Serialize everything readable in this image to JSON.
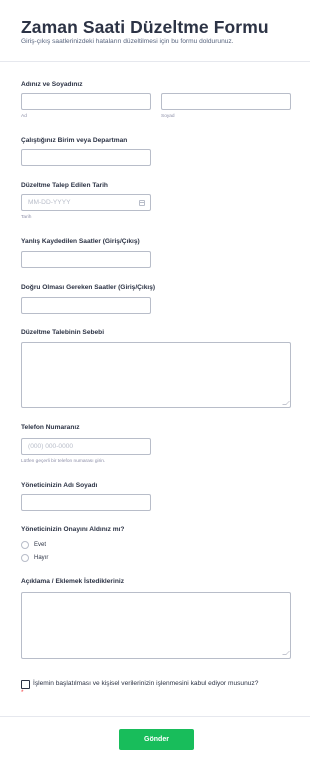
{
  "header": {
    "title": "Zaman Saati Düzeltme Formu",
    "subtitle": "Giriş-çıkış saatlerinizdeki hataların düzeltilmesi için bu formu doldurunuz."
  },
  "fields": {
    "name": {
      "label": "Adınız ve Soyadınız",
      "first_sublabel": "Ad",
      "last_sublabel": "Soyad",
      "first_value": "",
      "last_value": ""
    },
    "department": {
      "label": "Çalıştığınız Birim veya Departman",
      "value": ""
    },
    "date": {
      "label": "Düzeltme Talep Edilen Tarih",
      "placeholder": "MM-DD-YYYY",
      "sublabel": "Tarih",
      "value": ""
    },
    "wrong_hours": {
      "label": "Yanlış Kaydedilen Saatler (Giriş/Çıkış)",
      "value": ""
    },
    "correct_hours": {
      "label": "Doğru Olması Gereken Saatler (Giriş/Çıkış)",
      "value": ""
    },
    "reason": {
      "label": "Düzeltme Talebinin Sebebi",
      "value": ""
    },
    "phone": {
      "label": "Telefon Numaranız",
      "placeholder": "(000) 000-0000",
      "sublabel": "Lütfen geçerli bir telefon numarası girin.",
      "value": ""
    },
    "manager": {
      "label": "Yöneticinizin Adı Soyadı",
      "value": ""
    },
    "approval": {
      "label": "Yöneticinizin Onayını Aldınız mı?",
      "options": [
        "Evet",
        "Hayır"
      ]
    },
    "notes": {
      "label": "Açıklama / Eklemek İstedikleriniz",
      "value": ""
    },
    "consent": {
      "text": "İşlemin başlatılması ve kişisel verilerinizin işlenmesini kabul ediyor musunuz?",
      "required_mark": "*",
      "checked": false
    }
  },
  "submit": {
    "label": "Gönder",
    "color": "#18bd5b"
  },
  "colors": {
    "text": "#2c3345",
    "border": "#b8bdc9",
    "required": "#f23a3c"
  }
}
